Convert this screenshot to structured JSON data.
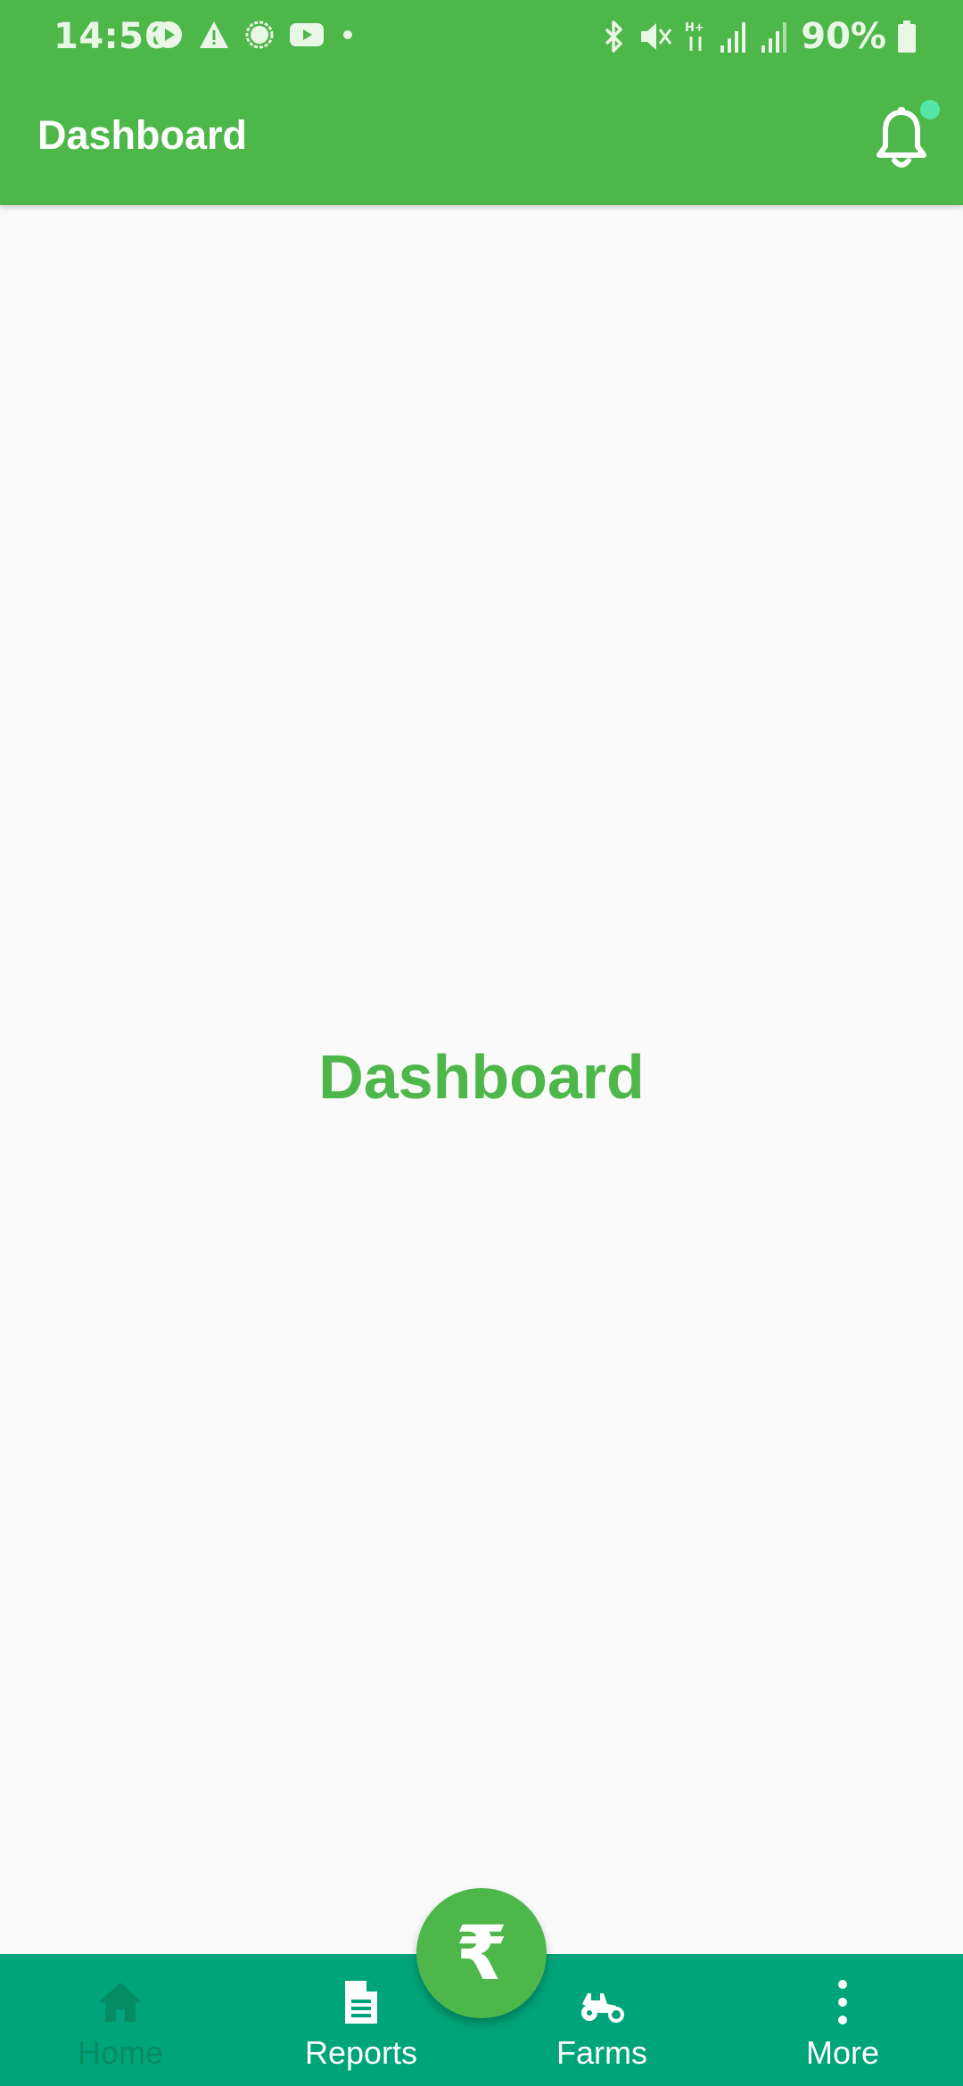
{
  "status_bar": {
    "time": "14:56",
    "battery": "90%",
    "left_icons": [
      "play-store-icon",
      "warning-icon",
      "signal-app-icon",
      "youtube-icon",
      "dot-icon"
    ],
    "right_icons": [
      "bluetooth-icon",
      "mute-icon",
      "data-hplus-icon",
      "signal-bars-icon",
      "signal-bars-2-icon",
      "battery-icon"
    ]
  },
  "app_bar": {
    "title": "Dashboard",
    "notification_icon": "bell-icon"
  },
  "main": {
    "heading": "Dashboard"
  },
  "fab": {
    "symbol": "₹",
    "icon": "rupee-icon"
  },
  "bottom_nav": {
    "items": [
      {
        "label": "Home",
        "icon": "home-icon",
        "active": true
      },
      {
        "label": "Reports",
        "icon": "document-icon"
      },
      {
        "label": "Farms",
        "icon": "tractor-icon"
      },
      {
        "label": "More",
        "icon": "more-vertical-icon"
      }
    ]
  },
  "colors": {
    "primary_green": "#4db74a",
    "bottom_nav": "#00a47a",
    "home_inactive": "#068b63",
    "notification_dot": "#54e6a6",
    "background": "#fafafa"
  }
}
